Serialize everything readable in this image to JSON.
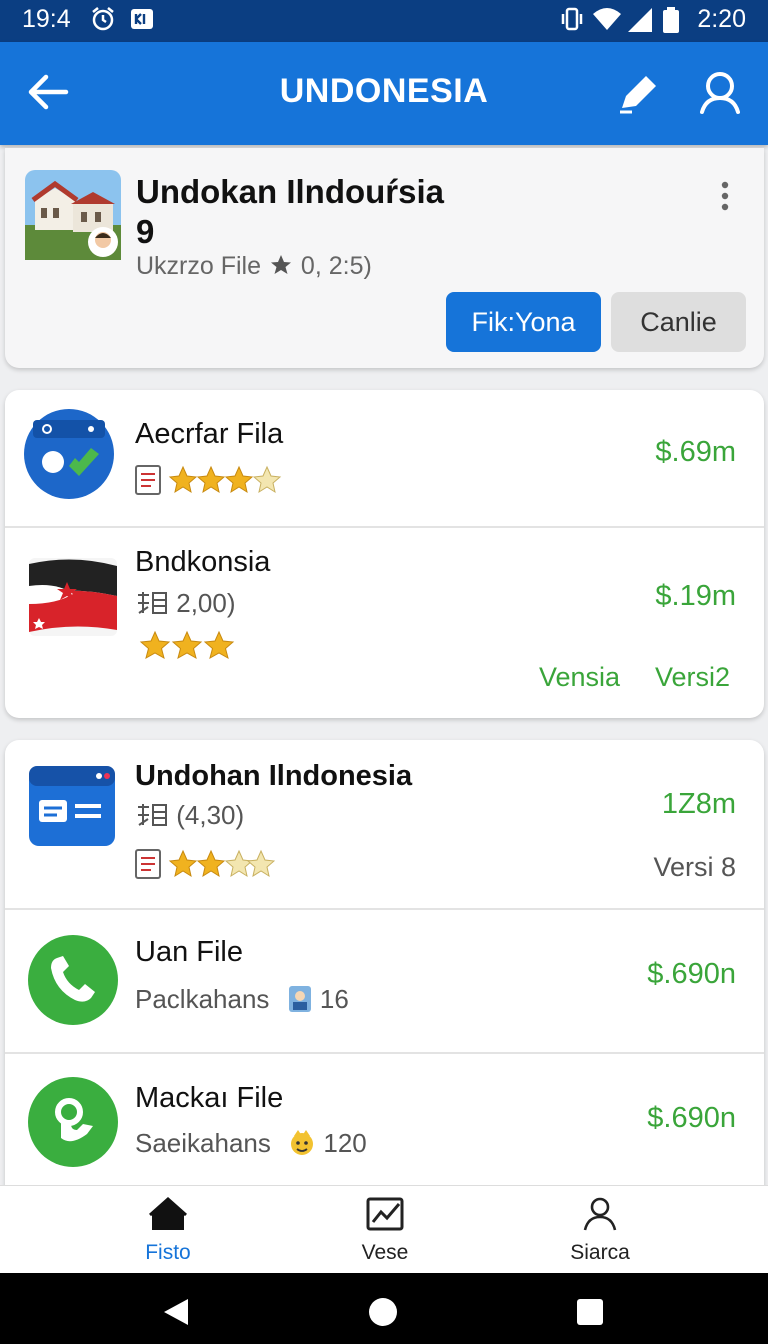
{
  "status_bar": {
    "time_left": "19:4",
    "time_right": "2:20"
  },
  "app_bar": {
    "title": "UNDONESIA"
  },
  "header_card": {
    "title_line1": "Undokan Ilndouŕsia",
    "title_line2": "9",
    "subtitle": "Ukzrzo File",
    "rating_text": "0,  2:5)",
    "primary_button": "Fik:Yona",
    "secondary_button": "Canlie"
  },
  "list_group1": [
    {
      "name": "Aecrfar Fila",
      "price": "$.69m",
      "rating": 3.5
    },
    {
      "name": "Bndkonsia",
      "meta": "2,00)",
      "price": "$.19m",
      "rating": 3,
      "link1": "Vensia",
      "link2": "Versi2"
    }
  ],
  "list_group2": [
    {
      "name": "Undohan  Ilndonesia",
      "meta": "(4,30)",
      "price": "1Z8m",
      "version": "Versi 8",
      "rating": 2.5
    },
    {
      "name": "Uan File",
      "meta": "Paclkahans",
      "count": "16",
      "price": "$.690n"
    },
    {
      "name": "Mackaı File",
      "meta": "Saeikahans",
      "count": "120",
      "price": "$.690n"
    }
  ],
  "bottom_nav": [
    {
      "label": "Fisto",
      "icon": "home-icon",
      "active": true
    },
    {
      "label": "Vese",
      "icon": "chart-icon",
      "active": false
    },
    {
      "label": "Siarca",
      "icon": "person-icon",
      "active": false
    }
  ],
  "colors": {
    "primary": "#1674d9",
    "status_bar": "#0b3e82",
    "price_green": "#3aa53a"
  }
}
